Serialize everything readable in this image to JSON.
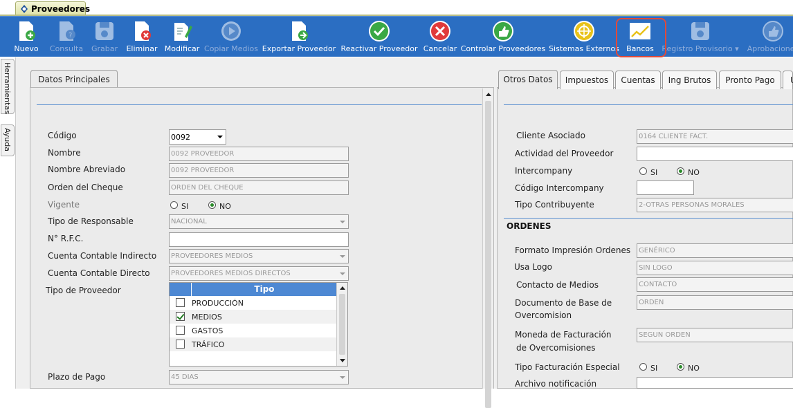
{
  "window_tab": {
    "title": "Proveedores"
  },
  "toolbar": {
    "buttons": [
      {
        "label": "Nuevo",
        "icon": "new-document-icon",
        "enabled": true
      },
      {
        "label": "Consulta",
        "icon": "query-document-icon",
        "enabled": false
      },
      {
        "label": "Grabar",
        "icon": "save-disk-icon",
        "enabled": false
      },
      {
        "label": "Eliminar",
        "icon": "delete-document-icon",
        "enabled": true
      },
      {
        "label": "Modificar",
        "icon": "edit-document-icon",
        "enabled": true
      },
      {
        "label": "Copiar Medios",
        "icon": "play-icon",
        "enabled": false
      },
      {
        "label": "Exportar Proveedor",
        "icon": "export-document-icon",
        "enabled": true
      },
      {
        "label": "Reactivar Proveedor",
        "icon": "checkmark-icon",
        "enabled": true
      },
      {
        "label": "Cancelar",
        "icon": "cancel-icon",
        "enabled": true
      },
      {
        "label": "Controlar Proveedores",
        "icon": "thumbs-up-icon",
        "enabled": true
      },
      {
        "label": "Sistemas Externos",
        "icon": "external-systems-icon",
        "enabled": true
      },
      {
        "label": "Bancos",
        "icon": "chart-line-icon",
        "enabled": true,
        "highlighted": true
      },
      {
        "label": "Registro Provisorio",
        "icon": "save-disk-icon",
        "enabled": false,
        "dropdown": true
      },
      {
        "label": "Aprobaciones",
        "icon": "thumbs-up-icon",
        "enabled": false
      }
    ]
  },
  "side_tabs": {
    "herramientas": "Herramientas",
    "ayuda": "Ayuda"
  },
  "left_panel": {
    "tab": "Datos Principales",
    "codigo": {
      "label": "Código",
      "value": "0092"
    },
    "nombre": {
      "label": "Nombre",
      "value": "0092 PROVEEDOR"
    },
    "nombre_abreviado": {
      "label": "Nombre Abreviado",
      "value": "0092 PROVEEDOR"
    },
    "orden_cheque": {
      "label": "Orden del Cheque",
      "value": "ORDEN DEL CHEQUE"
    },
    "vigente": {
      "label": "Vigente",
      "si": "SI",
      "no": "NO",
      "selected": "NO"
    },
    "tipo_responsable": {
      "label": "Tipo de Responsable",
      "value": "NACIONAL"
    },
    "rfc": {
      "label": "N° R.F.C.",
      "value": ""
    },
    "cuenta_indirecto": {
      "label": "Cuenta Contable Indirecto",
      "value": "PROVEEDORES MEDIOS"
    },
    "cuenta_directo": {
      "label": "Cuenta Contable Directo",
      "value": "PROVEEDORES MEDIOS DIRECTOS"
    },
    "tipo_proveedor": {
      "label": "Tipo de Proveedor",
      "header": "Tipo",
      "rows": [
        {
          "label": "PRODUCCIÓN",
          "checked": false
        },
        {
          "label": "MEDIOS",
          "checked": true
        },
        {
          "label": "GASTOS",
          "checked": false
        },
        {
          "label": "TRÁFICO",
          "checked": false
        }
      ]
    },
    "plazo_pago": {
      "label": "Plazo de Pago",
      "value": "45 DIAS"
    }
  },
  "right_panel": {
    "tabs": [
      "Otros Datos",
      "Impuestos",
      "Cuentas",
      "Ing Brutos",
      "Pronto Pago",
      "U"
    ],
    "cliente_asociado": {
      "label": "Cliente Asociado",
      "value": "0164 CLIENTE FACT."
    },
    "actividad": {
      "label": "Actividad del Proveedor",
      "value": ""
    },
    "intercompany": {
      "label": "Intercompany",
      "si": "SI",
      "no": "NO",
      "selected": "NO"
    },
    "codigo_intercompany": {
      "label": "Código Intercompany",
      "value": ""
    },
    "tipo_contribuyente": {
      "label": "Tipo Contribuyente",
      "value": "2-OTRAS PERSONAS MORALES"
    },
    "ordenes_title": "ORDENES",
    "formato_impresion": {
      "label": "Formato Impresión Ordenes",
      "value": "GENÉRICO"
    },
    "usa_logo": {
      "label": "Usa Logo",
      "value": "SIN LOGO"
    },
    "contacto_medios": {
      "label": "Contacto de Medios",
      "value": "CONTACTO"
    },
    "documento_base": {
      "label_line1": "Documento de Base de",
      "label_line2": "Overcomision",
      "value": "ORDEN"
    },
    "moneda_facturacion": {
      "label_line1": "Moneda de Facturación",
      "label_line2": "de Overcomisiones",
      "value": "SEGUN ORDEN"
    },
    "tipo_facturacion": {
      "label": "Tipo Facturación Especial",
      "si": "SI",
      "no": "NO",
      "selected": "NO"
    },
    "archivo_notificacion": {
      "label": "Archivo notificación",
      "value": ""
    }
  },
  "colors": {
    "toolbar": "#2b6ec2",
    "highlight": "#e04a3a",
    "grid_header": "#4d88d3",
    "separator": "#5a8fcf"
  }
}
